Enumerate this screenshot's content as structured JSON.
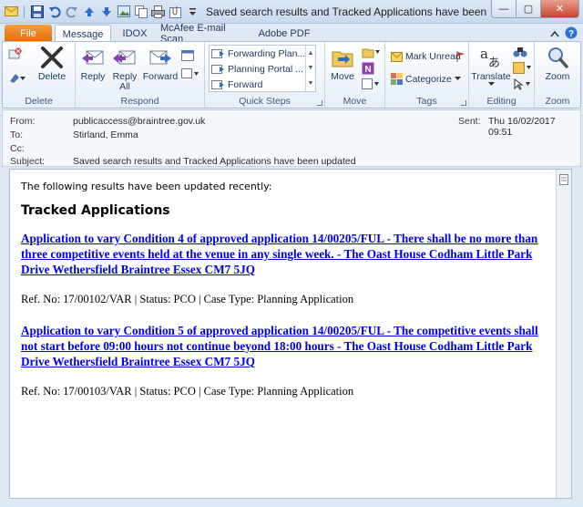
{
  "window": {
    "title": "Saved search results and Tracked Applications have been updated M",
    "controls": [
      "—",
      "▢",
      "✕"
    ]
  },
  "tabs": [
    {
      "label": "File"
    },
    {
      "label": "Message"
    },
    {
      "label": "IDOX"
    },
    {
      "label": "McAfee E-mail Scan"
    },
    {
      "label": "Adobe PDF"
    }
  ],
  "ribbon": {
    "delete": {
      "group": "Delete",
      "delete_label": "Delete"
    },
    "respond": {
      "group": "Respond",
      "reply": "Reply",
      "reply_all_1": "Reply",
      "reply_all_2": "All",
      "forward": "Forward"
    },
    "quick_steps": {
      "group": "Quick Steps",
      "items": [
        "Forwarding Plan...",
        "Planning Portal ...",
        "Forward"
      ]
    },
    "move": {
      "group": "Move",
      "move_label": "Move"
    },
    "tags": {
      "group": "Tags",
      "mark_unread": "Mark Unread",
      "categorize": "Categorize"
    },
    "editing": {
      "group": "Editing",
      "translate": "Translate"
    },
    "zoom": {
      "group": "Zoom",
      "zoom_label": "Zoom"
    }
  },
  "header": {
    "from_label": "From:",
    "from_value": "publicaccess@braintree.gov.uk",
    "to_label": "To:",
    "to_value": "Stirland, Emma",
    "cc_label": "Cc:",
    "cc_value": "",
    "subject_label": "Subject:",
    "subject_value": "Saved search results and Tracked Applications have been updated",
    "sent_label": "Sent:",
    "sent_value": "Thu 16/02/2017 09:51"
  },
  "message": {
    "intro": "The following results have been updated recently:",
    "heading": "Tracked Applications",
    "applications": [
      {
        "title": "Application to vary Condition 4 of approved application 14/00205/FUL - There shall be no more than three competitive events held at the venue in any single week. - The Oast House Codham Little Park Drive Wethersfield Braintree Essex CM7 5JQ",
        "ref": "Ref. No: 17/00102/VAR | Status: PCO | Case Type: Planning Application"
      },
      {
        "title": "Application to vary Condition 5 of approved application 14/00205/FUL - The competitive events shall not start before 09:00 hours not continue beyond 18:00 hours - The Oast House Codham Little Park Drive Wethersfield Braintree Essex CM7 5JQ",
        "ref": "Ref. No: 17/00103/VAR | Status: PCO | Case Type: Planning Application"
      }
    ]
  },
  "colors": {
    "accent_file_tab": "#e46c0a",
    "link": "#0000ee",
    "ribbon_text": "#1e395b"
  }
}
